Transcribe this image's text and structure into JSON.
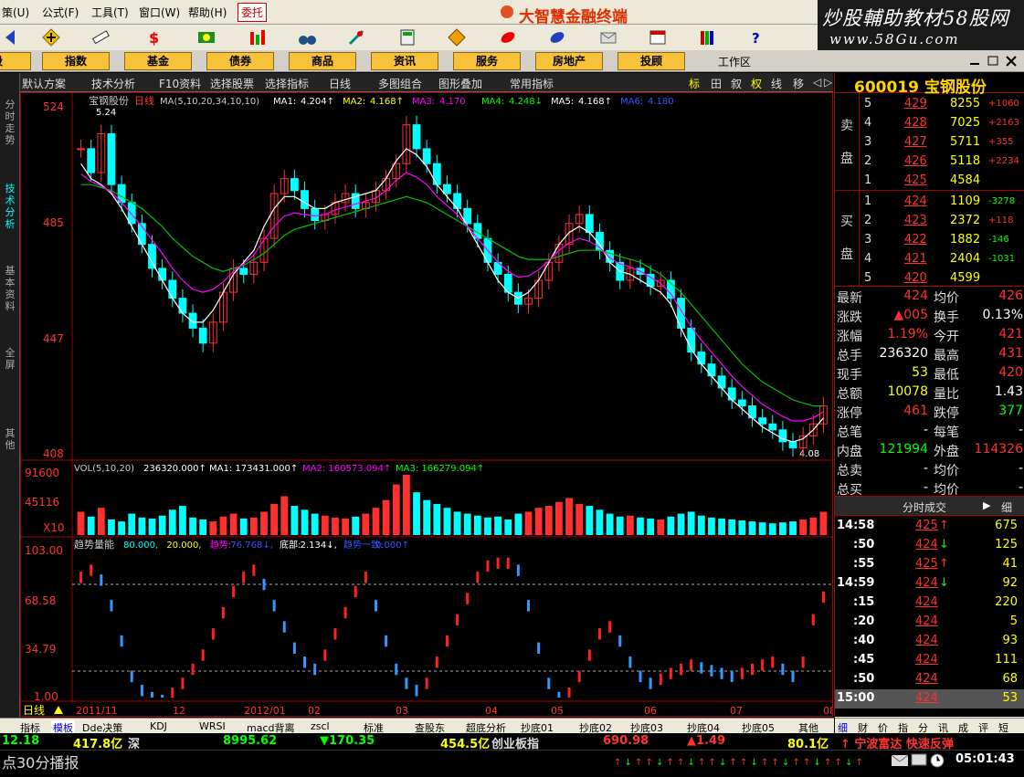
{
  "menu": [
    "策(U)",
    "公式(F)",
    "工具(T)",
    "窗口(W)",
    "帮助(H)",
    "委托"
  ],
  "brand": "大智慧金融终端",
  "watermark": {
    "line1": "炒股輔助教材58股网",
    "line2": "www.58Gu.com"
  },
  "nav_buttons": [
    "股",
    "指数",
    "基金",
    "债券",
    "商品",
    "资讯",
    "服务",
    "房地产",
    "投顾"
  ],
  "workspace_label": "工作区",
  "left_tabs": [
    "分时走势",
    "技术分析",
    "基本资料",
    "全屏",
    "其他"
  ],
  "subbar": {
    "items": [
      "默认方案",
      "技术分析",
      "F10资料",
      "选择股票",
      "选择指标",
      "日线",
      "多图组合",
      "图形叠加",
      "常用指标"
    ],
    "right_tabs": [
      "标",
      "田",
      "叙",
      "权",
      "线",
      "移",
      "◁",
      "▷"
    ]
  },
  "price_panel": {
    "name": "宝钢股份",
    "period": "日线",
    "ma_params": "MA(5,10,20,34,10,10)",
    "ma_values": [
      {
        "label": "MA1:",
        "value": "4.204↑",
        "color": "#ffffff"
      },
      {
        "label": "MA2:",
        "value": "4.168↑",
        "color": "#ffff00"
      },
      {
        "label": "MA3:",
        "value": "4.170",
        "color": "#ff00ff"
      },
      {
        "label": "MA4:",
        "value": "4.248↓",
        "color": "#00ff00"
      },
      {
        "label": "MA5:",
        "value": "4.168↑",
        "color": "#ffffff"
      },
      {
        "label": "MA6:",
        "value": "4.180",
        "color": "#3355ff"
      }
    ],
    "y_ticks": [
      "524",
      "485",
      "447",
      "408"
    ],
    "high_label": "5.24",
    "low_label": "4.08"
  },
  "volume_panel": {
    "title": "VOL(5,10,20)",
    "values": [
      {
        "label": "",
        "value": "236320.000↑",
        "color": "#ffffff"
      },
      {
        "label": "MA1:",
        "value": "173431.000↑",
        "color": "#ffffff"
      },
      {
        "label": "MA2:",
        "value": "160573.094↑",
        "color": "#ff00ff"
      },
      {
        "label": "MA3:",
        "value": "166279.094↑",
        "color": "#00ff00"
      }
    ],
    "y_ticks": [
      "91600",
      "45116",
      "X10"
    ]
  },
  "indicator_panel": {
    "title": "趋势量能",
    "params": [
      {
        "text": "80.000,",
        "color": "#00ffff"
      },
      {
        "text": "20.000,",
        "color": "#ffff00"
      },
      {
        "text": "趋势:",
        "color": "#ff00ff"
      },
      {
        "text": "76.768↓,",
        "color": "#3355ff"
      },
      {
        "text": "底部:",
        "color": "#ffffff"
      },
      {
        "text": "2.134↓,",
        "color": "#ffffff"
      },
      {
        "text": "趋势一致:",
        "color": "#3355ff"
      },
      {
        "text": "0.000↑",
        "color": "#3355ff"
      }
    ],
    "y_ticks": [
      "103.00",
      "68.58",
      "34.79",
      "1.00"
    ]
  },
  "x_axis": {
    "period_label": "日线",
    "labels": [
      "2011/11",
      "12",
      "2012/01",
      "02",
      "03",
      "04",
      "05",
      "06",
      "07",
      "08"
    ]
  },
  "stock": {
    "code": "600019",
    "name": "宝钢股份"
  },
  "order_book": {
    "sell_label": [
      "卖",
      "盘"
    ],
    "buy_label": [
      "买",
      "盘"
    ],
    "sells": [
      {
        "level": "5",
        "price": "429",
        "volume": "8255",
        "change": "+1060"
      },
      {
        "level": "4",
        "price": "428",
        "volume": "7025",
        "change": "+2163"
      },
      {
        "level": "3",
        "price": "427",
        "volume": "5711",
        "change": "+355"
      },
      {
        "level": "2",
        "price": "426",
        "volume": "5118",
        "change": "+2234"
      },
      {
        "level": "1",
        "price": "425",
        "volume": "4584",
        "change": ""
      }
    ],
    "buys": [
      {
        "level": "1",
        "price": "424",
        "volume": "1109",
        "change": "-3278"
      },
      {
        "level": "2",
        "price": "423",
        "volume": "2372",
        "change": "+118"
      },
      {
        "level": "3",
        "price": "422",
        "volume": "1882",
        "change": "-146"
      },
      {
        "level": "4",
        "price": "421",
        "volume": "2404",
        "change": "-1031"
      },
      {
        "level": "5",
        "price": "420",
        "volume": "4599",
        "change": ""
      }
    ]
  },
  "quote": [
    {
      "l1": "最新",
      "v1": "424",
      "c1": "#ff3030",
      "l2": "均价",
      "v2": "426",
      "c2": "#ff3030"
    },
    {
      "l1": "涨跌",
      "v1": "▲005",
      "c1": "#ff3030",
      "l2": "换手",
      "v2": "0.13%",
      "c2": "#ffffff"
    },
    {
      "l1": "涨幅",
      "v1": "1.19%",
      "c1": "#ff3030",
      "l2": "今开",
      "v2": "421",
      "c2": "#ff3030"
    },
    {
      "l1": "总手",
      "v1": "236320",
      "c1": "#ffffff",
      "l2": "最高",
      "v2": "431",
      "c2": "#ff3030"
    },
    {
      "l1": "现手",
      "v1": "53",
      "c1": "#ffff00",
      "l2": "最低",
      "v2": "420",
      "c2": "#ff3030"
    },
    {
      "l1": "总额",
      "v1": "10078",
      "c1": "#ffff00",
      "l2": "量比",
      "v2": "1.43",
      "c2": "#ffffff"
    },
    {
      "l1": "涨停",
      "v1": "461",
      "c1": "#ff3030",
      "l2": "跌停",
      "v2": "377",
      "c2": "#00ff00"
    },
    {
      "l1": "总笔",
      "v1": "-",
      "c1": "#ffffff",
      "l2": "每笔",
      "v2": "-",
      "c2": "#ffffff"
    },
    {
      "l1": "内盘",
      "v1": "121994",
      "c1": "#00ff00",
      "l2": "外盘",
      "v2": "114326",
      "c2": "#ff3030"
    },
    {
      "l1": "总卖",
      "v1": "-",
      "c1": "#ffffff",
      "l2": "均价",
      "v2": "-",
      "c2": "#ffffff"
    },
    {
      "l1": "总买",
      "v1": "-",
      "c1": "#ffffff",
      "l2": "均价",
      "v2": "-",
      "c2": "#ffffff"
    }
  ],
  "trades_header": "分时成交",
  "trades_detail": "细",
  "trades": [
    {
      "time": "14:58",
      "price": "425",
      "dir": "up",
      "vol": "675"
    },
    {
      "time": ":50",
      "price": "424",
      "dir": "down",
      "vol": "125"
    },
    {
      "time": ":55",
      "price": "425",
      "dir": "up",
      "vol": "41"
    },
    {
      "time": "14:59",
      "price": "424",
      "dir": "down",
      "vol": "92"
    },
    {
      "time": ":15",
      "price": "424",
      "dir": "",
      "vol": "220"
    },
    {
      "time": ":20",
      "price": "424",
      "dir": "",
      "vol": "5"
    },
    {
      "time": ":40",
      "price": "424",
      "dir": "",
      "vol": "93"
    },
    {
      "time": ":45",
      "price": "424",
      "dir": "",
      "vol": "111"
    },
    {
      "time": ":50",
      "price": "424",
      "dir": "",
      "vol": "68"
    },
    {
      "time": "15:00",
      "price": "424",
      "dir": "",
      "vol": "53"
    }
  ],
  "right_bottom_tabs": [
    "细",
    "财",
    "价",
    "指",
    "分",
    "讯",
    "成",
    "评",
    "短"
  ],
  "bottom_tabs": [
    "指标",
    "模板",
    "Dde决策",
    "KDJ",
    "WRSI",
    "macd背离",
    "zscl",
    "标准",
    "查股东",
    "超底分析",
    "抄底01",
    "抄底02",
    "抄底03",
    "抄底04",
    "抄底05",
    "其他"
  ],
  "status": {
    "v1": "12.18",
    "amt1": "417.8亿",
    "mkt1": "深",
    "idx2": "8995.62",
    "chg2": "▼170.35",
    "amt2": "454.5亿",
    "mkt2": "创业板指",
    "idx3": "690.98",
    "chg3": "▲1.49",
    "amt3": "80.1亿",
    "alert": "↑ 宁波富达 快速反弹"
  },
  "ticker": {
    "text": "点30分播报",
    "time": "05:01:43"
  },
  "chart_data": {
    "type": "candlestick",
    "x_axis_labels": [
      "2011/11",
      "12",
      "2012/01",
      "02",
      "03",
      "04",
      "05",
      "06",
      "07",
      "08"
    ],
    "price_close": [
      5.1,
      5.02,
      5.15,
      4.98,
      4.92,
      4.85,
      4.78,
      4.7,
      4.66,
      4.6,
      4.55,
      4.5,
      4.45,
      4.52,
      4.62,
      4.7,
      4.68,
      4.72,
      4.8,
      4.95,
      5.0,
      4.96,
      4.9,
      4.86,
      4.88,
      4.92,
      4.95,
      4.9,
      4.92,
      4.96,
      5.0,
      5.05,
      5.18,
      5.1,
      5.05,
      4.98,
      4.95,
      4.9,
      4.85,
      4.8,
      4.72,
      4.68,
      4.62,
      4.58,
      4.6,
      4.66,
      4.72,
      4.78,
      4.85,
      4.88,
      4.82,
      4.76,
      4.72,
      4.66,
      4.7,
      4.68,
      4.64,
      4.66,
      4.6,
      4.5,
      4.42,
      4.38,
      4.34,
      4.3,
      4.26,
      4.24,
      4.2,
      4.18,
      4.16,
      4.12,
      4.1,
      4.14,
      4.18,
      4.24
    ],
    "ma5": [
      5.05,
      5.0,
      4.98,
      4.95,
      4.9,
      4.84,
      4.78,
      4.72,
      4.66,
      4.6,
      4.55,
      4.52,
      4.52,
      4.56,
      4.62,
      4.68,
      4.72,
      4.76,
      4.84,
      4.9,
      4.94,
      4.94,
      4.92,
      4.9,
      4.9,
      4.92,
      4.93,
      4.94,
      4.95,
      4.96,
      5.0,
      5.06,
      5.1,
      5.08,
      5.04,
      4.98,
      4.94,
      4.9,
      4.84,
      4.78,
      4.72,
      4.66,
      4.62,
      4.6,
      4.62,
      4.66,
      4.72,
      4.78,
      4.82,
      4.84,
      4.82,
      4.78,
      4.72,
      4.69,
      4.68,
      4.66,
      4.64,
      4.62,
      4.58,
      4.5,
      4.43,
      4.38,
      4.34,
      4.3,
      4.26,
      4.23,
      4.2,
      4.17,
      4.15,
      4.13,
      4.12,
      4.13,
      4.16,
      4.2
    ],
    "ma34": [
      4.98,
      4.98,
      4.97,
      4.96,
      4.94,
      4.92,
      4.9,
      4.87,
      4.84,
      4.8,
      4.77,
      4.74,
      4.72,
      4.7,
      4.69,
      4.7,
      4.71,
      4.73,
      4.75,
      4.78,
      4.81,
      4.83,
      4.84,
      4.85,
      4.86,
      4.87,
      4.88,
      4.89,
      4.9,
      4.91,
      4.92,
      4.93,
      4.94,
      4.93,
      4.92,
      4.9,
      4.88,
      4.86,
      4.84,
      4.82,
      4.8,
      4.78,
      4.76,
      4.74,
      4.73,
      4.73,
      4.73,
      4.74,
      4.75,
      4.76,
      4.76,
      4.76,
      4.75,
      4.74,
      4.73,
      4.72,
      4.7,
      4.68,
      4.65,
      4.62,
      4.58,
      4.54,
      4.5,
      4.46,
      4.42,
      4.38,
      4.35,
      4.32,
      4.3,
      4.28,
      4.26,
      4.25,
      4.24,
      4.24
    ],
    "volume": [
      120,
      95,
      140,
      80,
      70,
      110,
      90,
      85,
      100,
      130,
      150,
      90,
      80,
      70,
      95,
      110,
      85,
      90,
      120,
      160,
      200,
      150,
      130,
      110,
      100,
      90,
      85,
      95,
      110,
      140,
      180,
      260,
      310,
      220,
      180,
      160,
      140,
      120,
      110,
      100,
      90,
      95,
      80,
      110,
      120,
      140,
      150,
      170,
      190,
      160,
      150,
      130,
      110,
      95,
      100,
      90,
      85,
      80,
      95,
      110,
      120,
      100,
      90,
      85,
      80,
      75,
      70,
      65,
      60,
      65,
      70,
      80,
      90,
      120
    ],
    "trend": [
      90,
      95,
      88,
      70,
      45,
      20,
      10,
      5,
      3,
      8,
      15,
      25,
      35,
      50,
      65,
      80,
      90,
      95,
      85,
      70,
      55,
      40,
      30,
      25,
      35,
      50,
      65,
      80,
      90,
      70,
      45,
      25,
      15,
      10,
      15,
      30,
      45,
      60,
      75,
      90,
      98,
      100,
      100,
      95,
      70,
      40,
      15,
      5,
      8,
      20,
      35,
      50,
      55,
      45,
      30,
      20,
      15,
      18,
      22,
      25,
      28,
      26,
      24,
      22,
      20,
      22,
      25,
      28,
      30,
      25,
      20,
      30,
      60,
      76
    ],
    "ylim_price": [
      4.08,
      5.24
    ],
    "ylim_volume": [
      0,
      91600
    ],
    "ylim_indicator": [
      1.0,
      103.0
    ]
  }
}
